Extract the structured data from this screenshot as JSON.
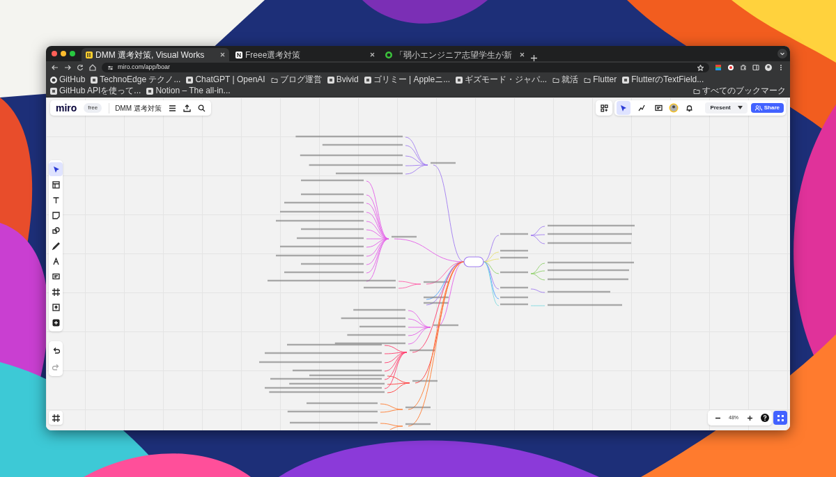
{
  "browser": {
    "tabs": [
      {
        "title": "DMM 選考対策, Visual Works",
        "selected": true
      },
      {
        "title": "Freee選考対策",
        "selected": false
      },
      {
        "title": "「弱小エンジニア志望学生が新",
        "selected": false
      }
    ],
    "url": "miro.com/app/boar",
    "bookmarks": [
      {
        "label": "GitHub",
        "kind": "github"
      },
      {
        "label": "TechnoEdge テクノ...",
        "kind": "site"
      },
      {
        "label": "ChatGPT | OpenAI",
        "kind": "site"
      },
      {
        "label": "ブログ運営",
        "kind": "folder"
      },
      {
        "label": "Bvivid",
        "kind": "site"
      },
      {
        "label": "ゴリミー | Appleニ...",
        "kind": "site"
      },
      {
        "label": "ギズモード・ジャパ...",
        "kind": "site"
      },
      {
        "label": "就活",
        "kind": "folder"
      },
      {
        "label": "Flutter",
        "kind": "folder"
      },
      {
        "label": "FlutterのTextField...",
        "kind": "site"
      },
      {
        "label": "GitHub APIを使って...",
        "kind": "site"
      },
      {
        "label": "Notion – The all-in...",
        "kind": "site"
      }
    ],
    "all_bookmarks": "すべてのブックマーク"
  },
  "board": {
    "logo": "miro",
    "plan": "free",
    "title": "DMM 選考対策",
    "tools": [
      {
        "kind": "cursor",
        "selected": true
      },
      {
        "kind": "templates",
        "selected": false
      },
      {
        "kind": "text",
        "selected": false
      },
      {
        "kind": "sticky",
        "selected": false
      },
      {
        "kind": "shapes",
        "selected": false
      },
      {
        "kind": "pen",
        "selected": false
      },
      {
        "kind": "curve",
        "selected": false
      },
      {
        "kind": "comment",
        "selected": false
      },
      {
        "kind": "frame",
        "selected": false
      },
      {
        "kind": "upload",
        "selected": false
      },
      {
        "kind": "plus",
        "selected": false
      }
    ],
    "present": "Present",
    "share": "Share",
    "zoom": "48%"
  }
}
